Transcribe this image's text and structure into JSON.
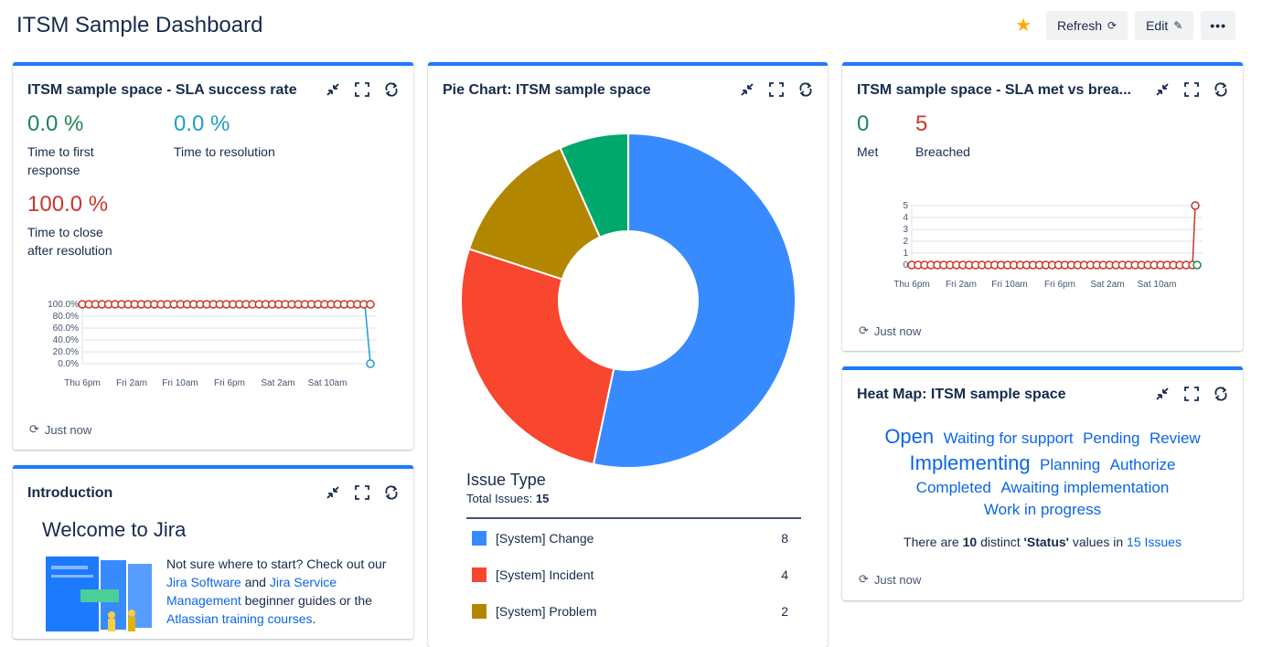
{
  "header": {
    "title": "ITSM Sample Dashboard",
    "refresh_label": "Refresh",
    "edit_label": "Edit",
    "more_label": "•••"
  },
  "sla_rate": {
    "title": "ITSM sample space - SLA success rate",
    "metrics": [
      {
        "value": "0.0 %",
        "label1": "Time to first",
        "label2": "response",
        "color": "#1f845a"
      },
      {
        "value": "0.0 %",
        "label1": "Time to resolution",
        "label2": "",
        "color": "#1d9fc9"
      },
      {
        "value": "100.0 %",
        "label1": "Time to close",
        "label2": "after resolution",
        "color": "#c9372c"
      }
    ],
    "y_ticks": [
      "100.0%",
      "80.0%",
      "60.0%",
      "40.0%",
      "20.0%",
      "0.0%"
    ],
    "x_ticks": [
      "Thu 6pm",
      "Fri 2am",
      "Fri 10am",
      "Fri 6pm",
      "Sat 2am",
      "Sat 10am"
    ],
    "refreshed": "Just now"
  },
  "pie": {
    "title": "Pie Chart: ITSM sample space",
    "legend_title": "Issue Type",
    "total_label": "Total Issues:",
    "total": "15",
    "items": [
      {
        "label": "[System] Change",
        "count": "8",
        "color": "#388bff"
      },
      {
        "label": "[System] Incident",
        "count": "4",
        "color": "#f8462f"
      },
      {
        "label": "[System] Problem",
        "count": "2",
        "color": "#b38600"
      },
      {
        "label": "",
        "count": "1",
        "color": "#00a86b"
      }
    ]
  },
  "chart_data": {
    "type": "pie",
    "title": "Pie Chart: ITSM sample space",
    "categories": [
      "[System] Change",
      "[System] Incident",
      "[System] Problem",
      ""
    ],
    "values": [
      8,
      4,
      2,
      1
    ]
  },
  "sla_met": {
    "title": "ITSM sample space - SLA met vs brea...",
    "met_value": "0",
    "met_label": "Met",
    "breached_value": "5",
    "breached_label": "Breached",
    "y_ticks": [
      "5",
      "4",
      "3",
      "2",
      "1",
      "0"
    ],
    "x_ticks": [
      "Thu 6pm",
      "Fri 2am",
      "Fri 10am",
      "Fri 6pm",
      "Sat 2am",
      "Sat 10am"
    ],
    "refreshed": "Just now"
  },
  "heatmap": {
    "title": "Heat Map: ITSM sample space",
    "row1": [
      "Open",
      "Waiting for support",
      "Pending",
      "Review"
    ],
    "row2": [
      "Implementing",
      "Planning",
      "Authorize"
    ],
    "row3": [
      "Completed",
      "Awaiting implementation"
    ],
    "row4": [
      "Work in progress"
    ],
    "summary_pre": "There are",
    "summary_count": "10",
    "summary_mid": "distinct",
    "summary_field": "'Status'",
    "summary_post": "values in",
    "summary_link": "15 Issues",
    "refreshed": "Just now"
  },
  "intro": {
    "title": "Introduction",
    "heading": "Welcome to Jira",
    "text1": "Not sure where to start? Check out our",
    "link1": "Jira Software",
    "text2": "and",
    "link2": "Jira Service Management",
    "text3": "beginner guides or the",
    "link3": "Atlassian training courses",
    "text4": "."
  }
}
